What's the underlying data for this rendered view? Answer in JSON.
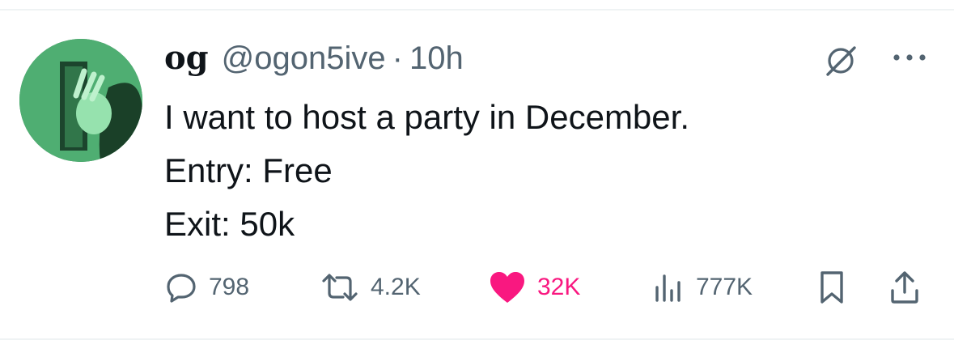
{
  "tweet": {
    "display_name": "og",
    "handle": "@ogon5ive",
    "separator": "·",
    "time": "10h",
    "lines": [
      "I want to host a party in December.",
      "Entry: Free",
      "Exit: 50k"
    ]
  },
  "actions": {
    "replies": "798",
    "reposts": "4.2K",
    "likes": "32K",
    "views": "777K"
  },
  "icons": {
    "reply": "reply-icon",
    "repost": "repost-icon",
    "like": "heart-icon",
    "views": "views-icon",
    "bookmark": "bookmark-icon",
    "share": "share-icon",
    "grok": "grok-icon",
    "more": "more-icon"
  },
  "colors": {
    "text": "#0f1419",
    "secondary": "#536471",
    "like": "#f91880",
    "divider": "#eff3f4"
  }
}
